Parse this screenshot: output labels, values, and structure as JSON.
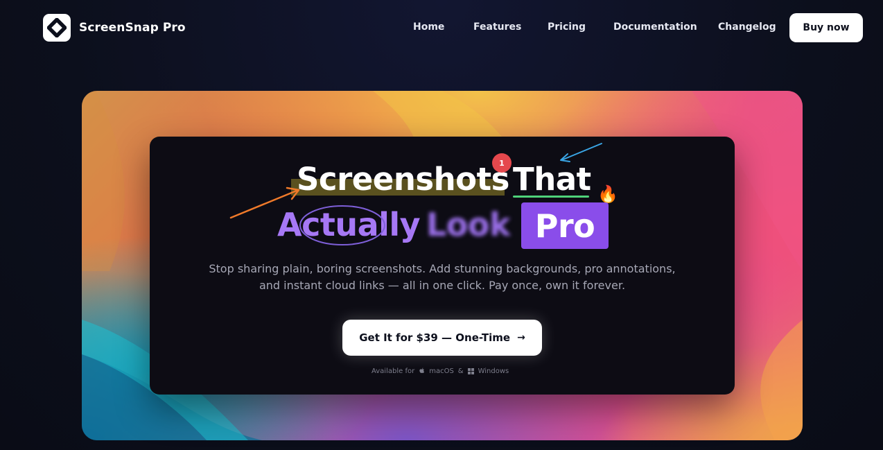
{
  "nav": {
    "brand_name": "ScreenSnap Pro",
    "links": [
      "Home",
      "Features",
      "Pricing",
      "Documentation",
      "Changelog"
    ],
    "buy_label": "Buy now"
  },
  "hero": {
    "headline_word1": "Screenshots",
    "headline_word2": "That",
    "headline_word3": "Actually",
    "headline_word4": "Look",
    "headline_word5": "Pro",
    "badge_count": "1",
    "fire_emoji": "🔥",
    "subtitle": "Stop sharing plain, boring screenshots. Add stunning backgrounds, pro annotations, and instant cloud links — all in one click. Pay once, own it forever.",
    "cta_label": "Get It for $39 — One-Time",
    "cta_arrow": "→",
    "available_prefix": "Available for",
    "platform_1": "macOS",
    "platform_sep": "&",
    "platform_2": "Windows"
  },
  "colors": {
    "page_bg": "#0c0f1c",
    "card_bg": "#0d0c14",
    "accent_purple": "#8a4dea",
    "highlight_green": "#4fd27a",
    "badge_red": "#e5484d",
    "arrow_orange": "#f07a2a",
    "arrow_blue": "#3aa6e6"
  }
}
